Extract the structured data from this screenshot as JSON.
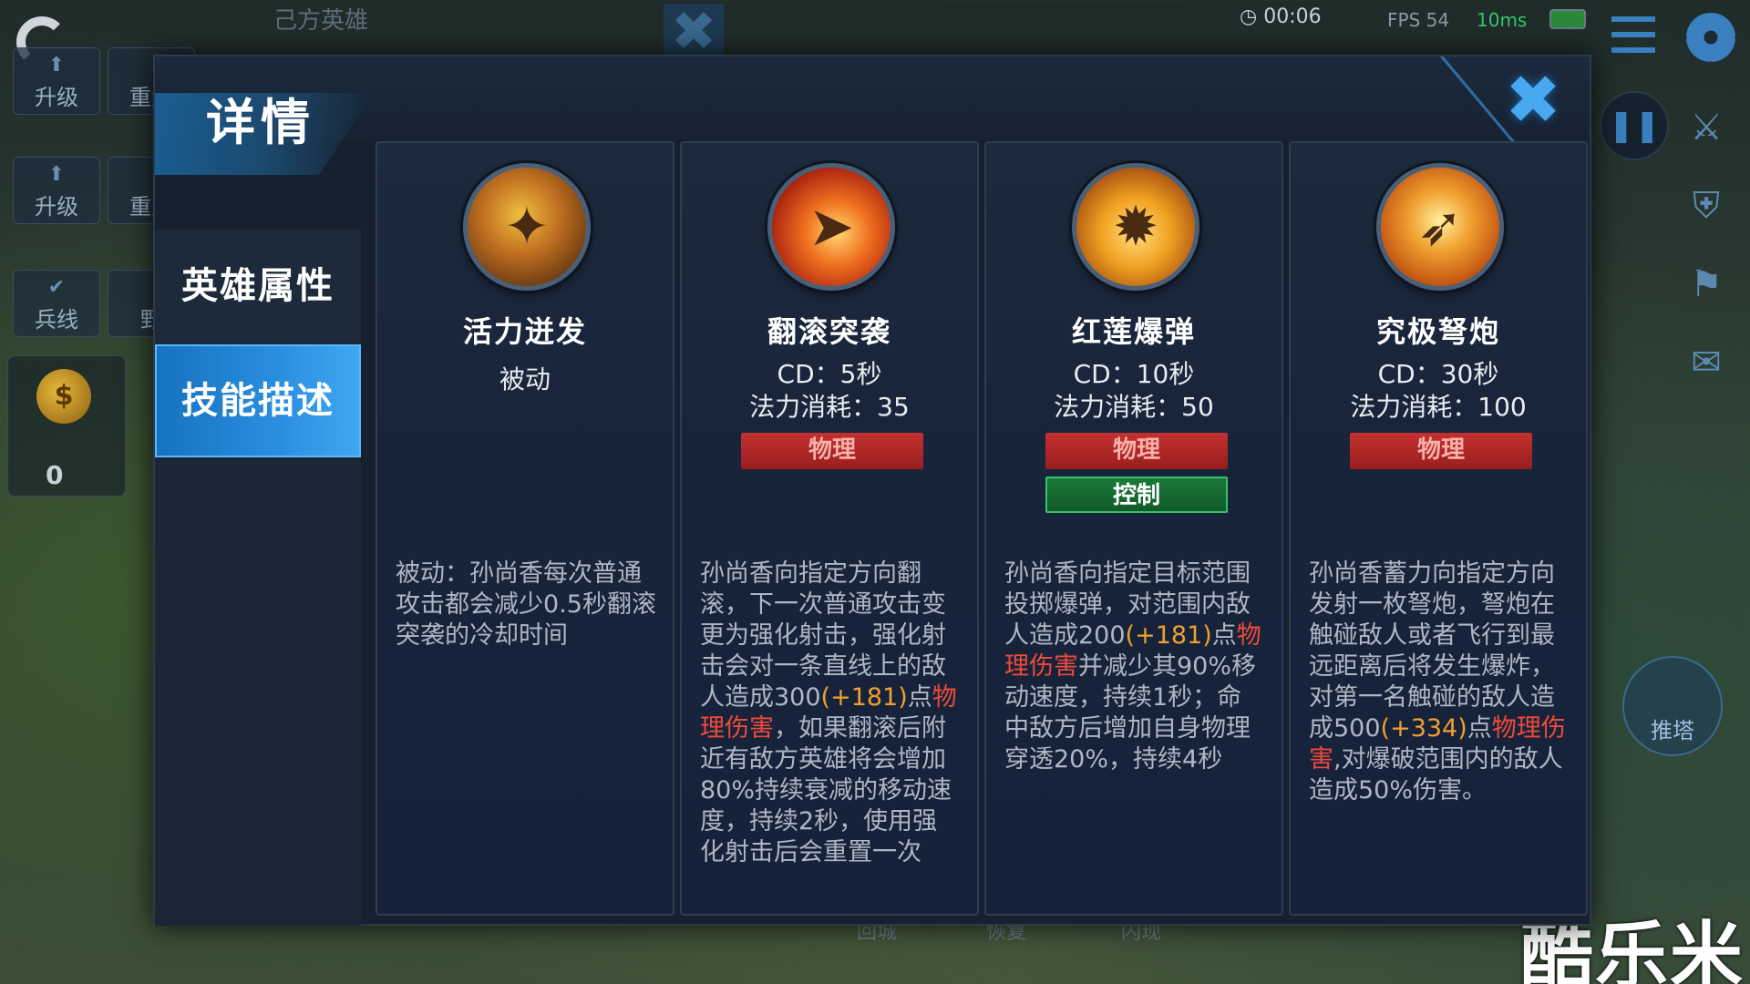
{
  "background_hud": {
    "own_heroes_label": "己方英雄",
    "buttons": [
      {
        "label": "升级"
      },
      {
        "label": "重置"
      },
      {
        "label": "升级"
      },
      {
        "label": "重置"
      },
      {
        "label": "兵线"
      },
      {
        "label": "野"
      }
    ],
    "gold": "$",
    "gold_count": "0",
    "time": "00:06",
    "fps": "FPS 54",
    "ping": "10ms",
    "push_tower_label": "推塔",
    "bottom_labels": [
      "回城",
      "恢复",
      "闪现"
    ],
    "watermark": "酷乐米"
  },
  "modal": {
    "title": "详情",
    "close_icon": "close-icon",
    "tabs": [
      {
        "label": "英雄属性",
        "active": false
      },
      {
        "label": "技能描述",
        "active": true
      }
    ],
    "skills": [
      {
        "name": "活力迸发",
        "type_label": "被动",
        "icon": "passive-hero-icon",
        "desc": "被动：孙尚香每次普通攻击都会减少0.5秒翻滚突袭的冷却时间"
      },
      {
        "name": "翻滚突袭",
        "cd": "CD：5秒",
        "mana": "法力消耗：35",
        "tags": [
          "物理"
        ],
        "icon": "roll-bullet-icon",
        "desc_parts": [
          "孙尚香向指定方向翻滚，下一次普通攻击变更为强化射击，强化射击会对一条直线上的敌人造成300",
          "(+181)",
          "点",
          "物理伤害",
          "，如果翻滚后附近有敌方英雄将会增加80%持续衰减的移动速度，持续2秒，使用强化射击后会重置一次"
        ]
      },
      {
        "name": "红莲爆弹",
        "cd": "CD：10秒",
        "mana": "法力消耗：50",
        "tags": [
          "物理",
          "控制"
        ],
        "icon": "spiked-bomb-icon",
        "desc_parts": [
          "孙尚香向指定目标范围投掷爆弹，对范围内敌人造成200",
          "(+181)",
          "点",
          "物理伤害",
          "并减少其90%移动速度，持续1秒；命中敌方后增加自身物理穿透20%，持续4秒"
        ]
      },
      {
        "name": "究极弩炮",
        "cd": "CD：30秒",
        "mana": "法力消耗：100",
        "tags": [
          "物理"
        ],
        "icon": "cannon-shell-icon",
        "desc_parts": [
          "孙尚香蓄力向指定方向发射一枚弩炮，弩炮在触碰敌人或者飞行到最远距离后将发生爆炸，对第一名触碰的敌人造成500",
          "(+334)",
          "点",
          "物理伤害",
          ",对爆破范围内的敌人造成50%伤害。"
        ]
      }
    ]
  }
}
